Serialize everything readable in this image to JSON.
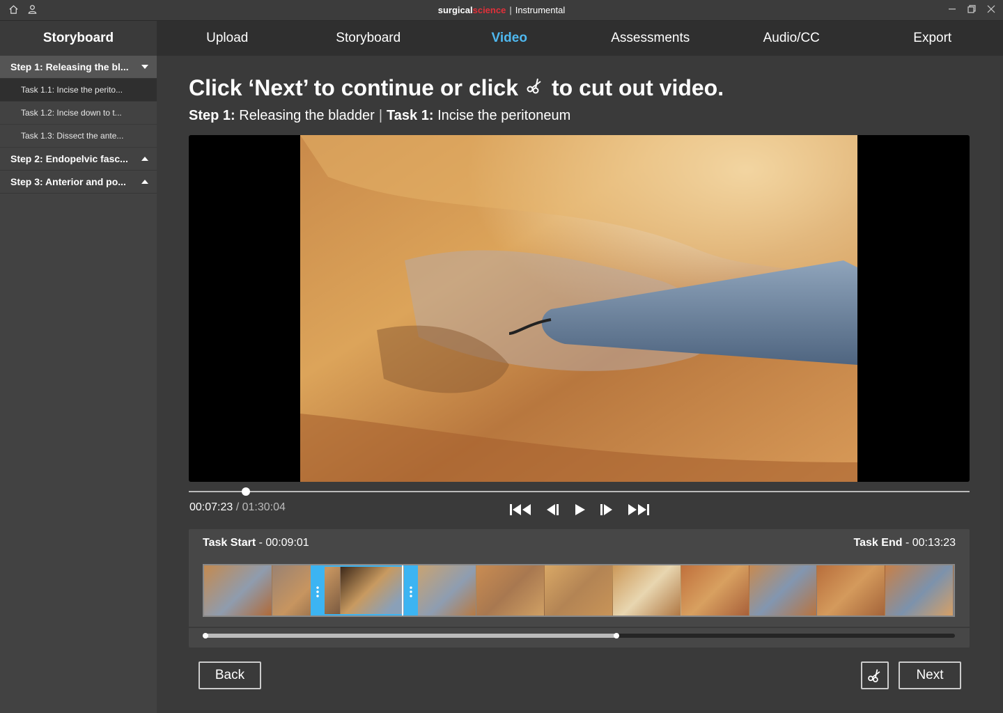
{
  "titlebar": {
    "brand_part1": "surgical",
    "brand_part2": "science",
    "separator": "|",
    "app_name": "Instrumental",
    "icons": [
      "home-icon",
      "user-icon",
      "minimize-icon",
      "restore-icon",
      "close-icon"
    ]
  },
  "sidebar": {
    "title": "Storyboard",
    "steps": [
      {
        "label": "Step 1: Releasing the bl...",
        "expanded": true,
        "tasks": [
          {
            "label": "Task 1.1: Incise the perito..."
          },
          {
            "label": "Task 1.2: Incise down to t..."
          },
          {
            "label": "Task 1.3: Dissect the ante..."
          }
        ]
      },
      {
        "label": "Step 2: Endopelvic fasc...",
        "expanded": false
      },
      {
        "label": "Step 3: Anterior and po...",
        "expanded": false
      }
    ]
  },
  "nav": {
    "tabs": [
      {
        "label": "Upload"
      },
      {
        "label": "Storyboard"
      },
      {
        "label": "Video"
      },
      {
        "label": "Assessments"
      },
      {
        "label": "Audio/CC"
      },
      {
        "label": "Export"
      }
    ],
    "active": "Video"
  },
  "main": {
    "headline_before": "Click ‘Next’ to continue or click",
    "headline_after": "to cut out video.",
    "step_label": "Step 1:",
    "step_name": "Releasing the bladder",
    "divider": "|",
    "task_label": "Task 1:",
    "task_name": "Incise the peritoneum"
  },
  "player": {
    "current_time": "00:07:23",
    "time_separator": " / ",
    "total_time": "01:30:04",
    "progress_fraction": 0.073
  },
  "trim": {
    "start_label": "Task Start",
    "start_time": " - 00:09:01",
    "end_label": "Task End",
    "end_time": " - 00:13:23",
    "zoom_fraction": 0.55
  },
  "buttons": {
    "back": "Back",
    "next": "Next"
  },
  "colors": {
    "accent": "#4fb8ef",
    "selection": "#3cb4f2",
    "brand_red": "#e0303a"
  }
}
